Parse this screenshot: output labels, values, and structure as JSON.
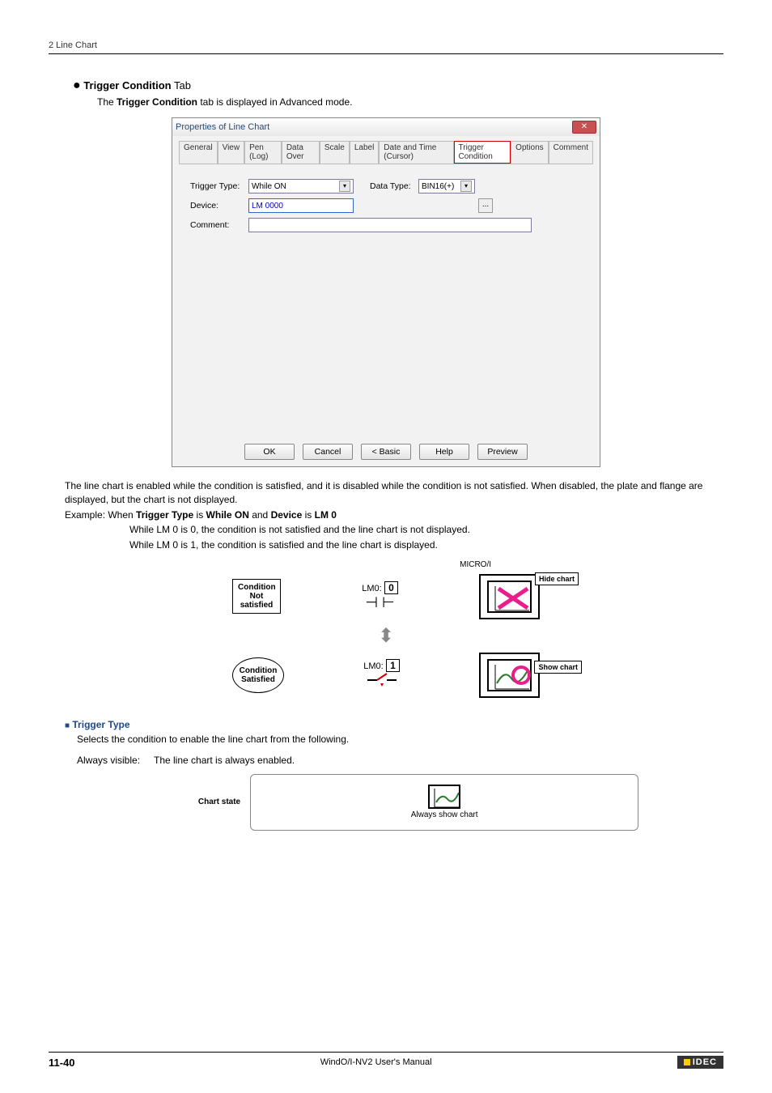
{
  "header": {
    "title": "2 Line Chart"
  },
  "section": {
    "bullet": "●",
    "title_bold": "Trigger Condition",
    "title_rest": " Tab",
    "desc_pre": "The ",
    "desc_bold": "Trigger Condition",
    "desc_post": " tab is displayed in Advanced mode."
  },
  "dialog": {
    "title": "Properties of Line Chart",
    "close": "✕",
    "tabs": [
      "General",
      "View",
      "Pen (Log)",
      "Data Over",
      "Scale",
      "Label",
      "Date and Time (Cursor)",
      "Trigger Condition",
      "Options",
      "Comment"
    ],
    "labels": {
      "trigger_type": "Trigger Type:",
      "device": "Device:",
      "comment": "Comment:",
      "data_type": "Data Type:"
    },
    "values": {
      "trigger_type": "While ON",
      "device": "LM 0000",
      "data_type": "BIN16(+)"
    },
    "buttons": {
      "ok": "OK",
      "cancel": "Cancel",
      "basic": "< Basic",
      "help": "Help",
      "preview": "Preview"
    }
  },
  "body": {
    "p1": "The line chart is enabled while the condition is satisfied, and it is disabled while the condition is not satisfied. When disabled, the plate and flange are displayed, but the chart is not displayed.",
    "ex_pre": "Example: When ",
    "ex_b1": "Trigger Type",
    "ex_mid1": " is ",
    "ex_b2": "While ON",
    "ex_mid2": " and ",
    "ex_b3": "Device",
    "ex_mid3": " is ",
    "ex_b4": "LM 0",
    "ex_line1": "While LM 0 is 0, the condition is not satisfied and the line chart is not displayed.",
    "ex_line2": "While LM 0 is 1, the condition is satisfied and the line chart is displayed."
  },
  "diagram": {
    "micro_label": "MICRO/I",
    "cond_not": "Condition Not satisfied",
    "cond_sat": "Condition Satisfied",
    "lm0_label": "LM0:",
    "lm0_val0": "0",
    "lm0_val1": "1",
    "hide_chart": "Hide chart",
    "show_chart": "Show chart"
  },
  "trigger_type_section": {
    "bullet": "■",
    "title": "Trigger Type",
    "desc": "Selects the condition to enable the line chart from the following.",
    "always_visible": "Always visible:",
    "always_visible_desc": "The line chart is always enabled."
  },
  "chart_state": {
    "label": "Chart state",
    "caption": "Always show chart"
  },
  "footer": {
    "page": "11-40",
    "manual": "WindO/I-NV2 User's Manual",
    "brand": "IDEC"
  }
}
